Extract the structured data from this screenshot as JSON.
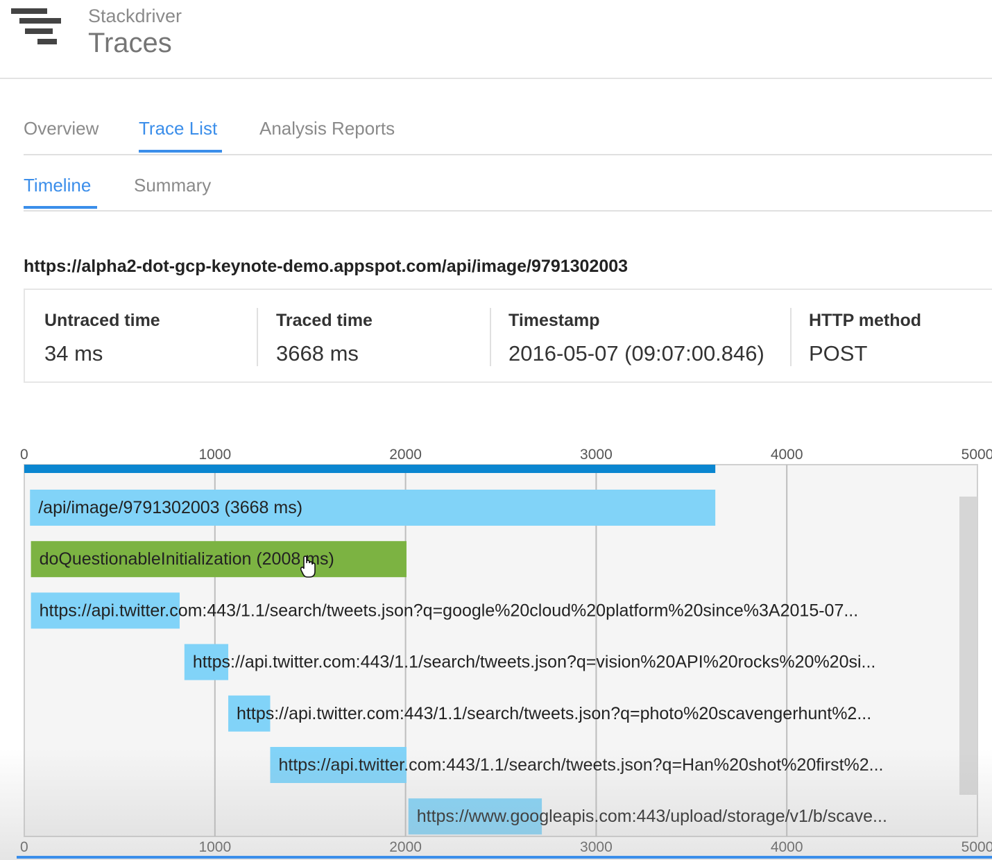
{
  "header": {
    "product": "Stackdriver",
    "title": "Traces"
  },
  "tabs": [
    {
      "label": "Overview",
      "active": false
    },
    {
      "label": "Trace List",
      "active": true
    },
    {
      "label": "Analysis Reports",
      "active": false
    }
  ],
  "subtabs": [
    {
      "label": "Timeline",
      "active": true
    },
    {
      "label": "Summary",
      "active": false
    }
  ],
  "trace": {
    "url": "https://alpha2-dot-gcp-keynote-demo.appspot.com/api/image/9791302003",
    "stats": [
      {
        "label": "Untraced time",
        "value": "34 ms"
      },
      {
        "label": "Traced time",
        "value": "3668 ms"
      },
      {
        "label": "Timestamp",
        "value": "2016-05-07 (09:07:00.846)"
      },
      {
        "label": "HTTP method",
        "value": "POST"
      }
    ]
  },
  "colors": {
    "accent": "#3b8eea",
    "overall_bar": "#0a86d0",
    "rpc_span": "#81d3f8",
    "local_span": "#7cb342"
  },
  "chart_data": {
    "type": "bar",
    "orientation": "horizontal-gantt",
    "xlim": [
      0,
      5000
    ],
    "x_ticks": [
      0,
      1000,
      2000,
      3000,
      4000,
      5000
    ],
    "x_tick_labels": [
      "0",
      "1000",
      "2000",
      "3000",
      "4000",
      "5000"
    ],
    "grid": true,
    "overall": {
      "start": 0,
      "end": 3625
    },
    "spans": [
      {
        "label": "/api/image/9791302003 (3668 ms)",
        "start": 30,
        "end": 3625,
        "kind": "rpc"
      },
      {
        "label": "doQuestionableInitialization (2008 ms)",
        "start": 35,
        "end": 2005,
        "kind": "local"
      },
      {
        "label": "https://api.twitter.com:443/1.1/search/tweets.json?q=google%20cloud%20platform%20since%3A2015-07...",
        "start": 35,
        "end": 815,
        "kind": "rpc"
      },
      {
        "label": "https://api.twitter.com:443/1.1/search/tweets.json?q=vision%20API%20rocks%20%20si...",
        "start": 840,
        "end": 1070,
        "kind": "rpc"
      },
      {
        "label": "https://api.twitter.com:443/1.1/search/tweets.json?q=photo%20scavengerhunt%2...",
        "start": 1070,
        "end": 1290,
        "kind": "rpc"
      },
      {
        "label": "https://api.twitter.com:443/1.1/search/tweets.json?q=Han%20shot%20first%2...",
        "start": 1290,
        "end": 2005,
        "kind": "rpc"
      },
      {
        "label": "https://www.googleapis.com:443/upload/storage/v1/b/scave...",
        "start": 2015,
        "end": 2715,
        "kind": "rpc"
      }
    ]
  }
}
